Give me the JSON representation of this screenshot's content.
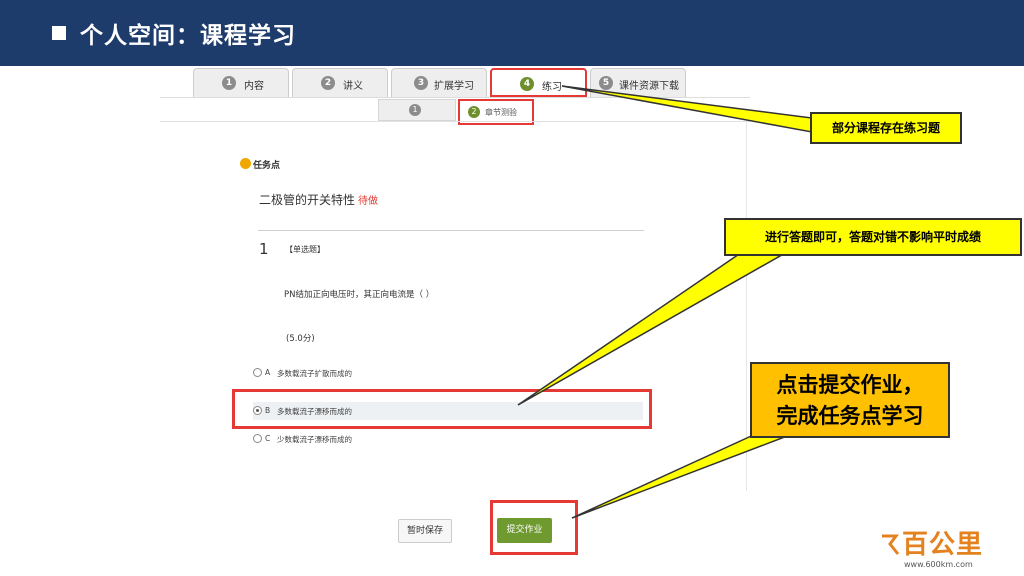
{
  "slide": {
    "title": "个人空间：课程学习"
  },
  "tabs": [
    {
      "num": "1",
      "label": "内容"
    },
    {
      "num": "2",
      "label": "讲义"
    },
    {
      "num": "3",
      "label": "扩展学习"
    },
    {
      "num": "4",
      "label": "练习"
    },
    {
      "num": "5",
      "label": "课件资源下载"
    }
  ],
  "subtabs": [
    {
      "num": "1",
      "label": ""
    },
    {
      "num": "2",
      "label": "章节测验"
    }
  ],
  "task": {
    "section_label": "任务点",
    "title": "二极管的开关特性",
    "status": "待做"
  },
  "question": {
    "number": "1",
    "type": "【单选题】",
    "text": "PN结加正向电压时，其正向电流是（ ）",
    "score": "(5.0分)",
    "options": [
      {
        "letter": "A",
        "text": "多数载流子扩散而成的"
      },
      {
        "letter": "B",
        "text": "多数载流子漂移而成的"
      },
      {
        "letter": "C",
        "text": "少数载流子漂移而成的"
      }
    ]
  },
  "buttons": {
    "save": "暂时保存",
    "submit": "提交作业"
  },
  "callouts": {
    "practice": "部分课程存在练习题",
    "answer": "进行答题即可，答题对错不影响平时成绩",
    "submit_line1": "点击提交作业，",
    "submit_line2": "完成任务点学习"
  },
  "logo": {
    "text": "百公里",
    "url": "www.600km.com"
  },
  "colors": {
    "header": "#1d3b6b",
    "highlight": "#e53935",
    "callout_yellow": "#ffff00",
    "callout_orange": "#ffc000",
    "submit_green": "#6f9a2f"
  }
}
